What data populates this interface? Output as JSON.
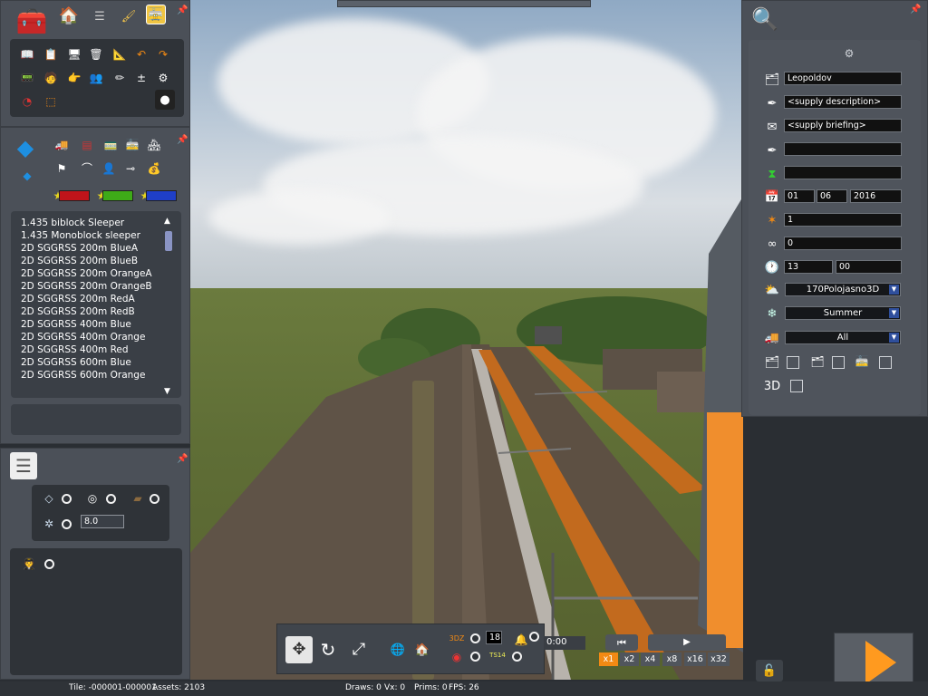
{
  "assets": {
    "list": [
      "1.435 biblock Sleeper",
      "1.435 Monoblock sleeper",
      "2D SGGRSS 200m BlueA",
      "2D SGGRSS 200m BlueB",
      "2D SGGRSS 200m OrangeA",
      "2D SGGRSS 200m OrangeB",
      "2D SGGRSS 200m RedA",
      "2D SGGRSS 200m RedB",
      "2D SGGRSS 400m Blue",
      "2D SGGRSS 400m Orange",
      "2D SGGRSS 400m Red",
      "2D SGGRSS 600m Blue",
      "2D SGGRSS 600m Orange"
    ]
  },
  "tools": {
    "spacing_value": "8.0"
  },
  "session": {
    "name": "Leopoldov",
    "description": "<supply description>",
    "briefing": "<supply briefing>",
    "day": "01",
    "month": "06",
    "year": "2016",
    "field_1": "1",
    "field_2": "0",
    "hour": "13",
    "minute": "00",
    "weather": "170Polojasno3D",
    "season": "Summer",
    "filter": "All"
  },
  "playback": {
    "counter": "18",
    "ts_label": "TS14",
    "zoom_label": "3DZ",
    "time": "0:00",
    "speeds": [
      "x1",
      "x2",
      "x4",
      "x8",
      "x16",
      "x32"
    ],
    "active_speed": "x1"
  },
  "status": {
    "tile": "Tile: -000001-000001",
    "assets": "Assets: 2103",
    "draws": "Draws: 0",
    "vx": "Vx: 0",
    "prims": "Prims: 0",
    "fps": "FPS: 26"
  },
  "colors": {
    "accent": "#f38a13",
    "panel": "#4b5058",
    "field_bg": "#111111"
  }
}
